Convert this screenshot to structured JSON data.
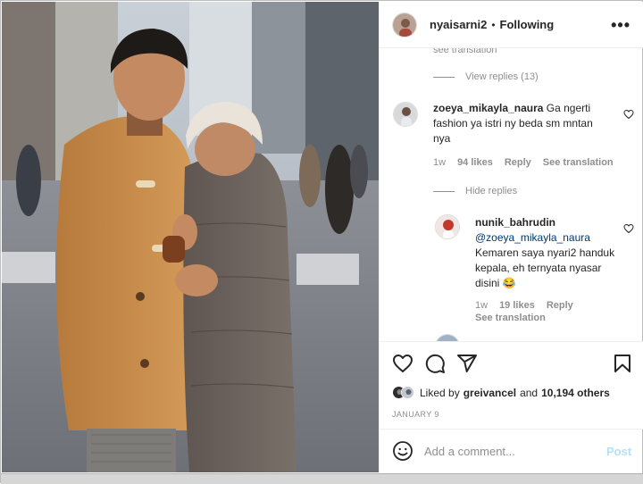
{
  "post": {
    "username": "nyaisarni2",
    "separator": "•",
    "follow_state": "Following",
    "more_label": "•••"
  },
  "comments": {
    "cut_off_text": "see translation",
    "view_replies": "View replies (13)",
    "hide_replies": "Hide replies",
    "comment_1": {
      "username": "zoeya_mikayla_naura",
      "text": "Ga ngerti fashion ya istri ny beda sm mntan nya",
      "time": "1w",
      "likes": "94 likes",
      "reply": "Reply",
      "translate": "See translation"
    },
    "reply_1": {
      "username": "nunik_bahrudin",
      "mention": "@zoeya_mikayla_naura",
      "text": "Kemaren saya nyari2 handuk kepala, eh ternyata nyasar disini 😂",
      "time": "1w",
      "likes": "19 likes",
      "reply": "Reply",
      "translate": "See translation"
    }
  },
  "likes": {
    "prefix": "Liked by",
    "user": "greivancel",
    "joiner": "and",
    "count": "10,194 others"
  },
  "date": "JANUARY 9",
  "composer": {
    "placeholder": "Add a comment...",
    "post_label": "Post"
  },
  "icons": [
    "heart-icon",
    "comment-icon",
    "share-icon",
    "bookmark-icon",
    "emoji-icon",
    "more-icon"
  ],
  "colors": {
    "link": "#00376b",
    "muted": "#8e8e8e",
    "post_button_disabled": "#b2dffc"
  }
}
